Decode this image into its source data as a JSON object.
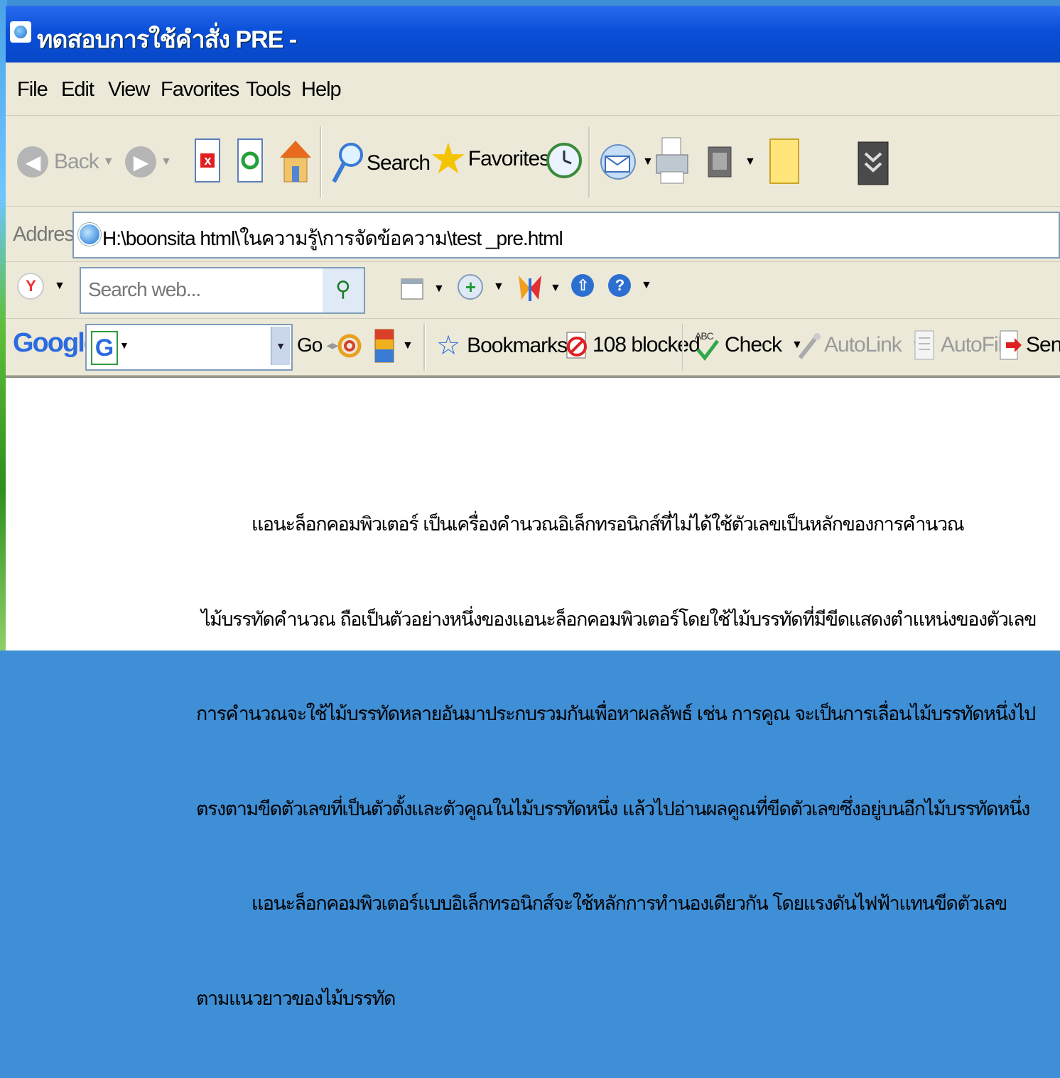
{
  "window": {
    "title": "ทดสอบการใช้คำสั่ง PRE -"
  },
  "menu": {
    "items": [
      "File",
      "Edit",
      "View",
      "Favorites",
      "Tools",
      "Help"
    ]
  },
  "toolbar": {
    "back_label": "Back",
    "search_label": "Search",
    "favorites_label": "Favorites"
  },
  "address": {
    "label": "Address",
    "url": "H:\\boonsita html\\ในความรู้\\การจัดข้อความ\\test _pre.html"
  },
  "yahoo_toolbar": {
    "search_placeholder": "Search web..."
  },
  "google_toolbar": {
    "logo": "Google",
    "go_label": "Go",
    "bookmarks_label": "Bookmarks",
    "blocked_label": "108 blocked",
    "check_label": "Check",
    "autolink_label": "AutoLink",
    "autofill_label": "AutoFill",
    "send_label": "Send"
  },
  "content": {
    "lines": [
      "           แอนะล็อกคอมพิวเตอร์ เป็นเครื่องคำนวณอิเล็กทรอนิกส์ที่ไม่ได้ใช้ตัวเลขเป็นหลักของการคำนวณ",
      " ไม้บรรทัดคำนวณ ถือเป็นตัวอย่างหนึ่งของแอนะล็อกคอมพิวเตอร์โดยใช้ไม้บรรทัดที่มีขีดแสดงตำแหน่งของตัวเลข",
      "การคำนวณจะใช้ไม้บรรทัดหลายอันมาประกบรวมกันเพื่อหาผลลัพธ์ เช่น การคูณ จะเป็นการเลื่อนไม้บรรทัดหนึ่งไป",
      "ตรงตามขีดตัวเลขที่เป็นตัวตั้งและตัวคูณในไม้บรรทัดหนึ่ง แล้วไปอ่านผลคูณที่ขีดตัวเลขซึ่งอยู่บนอีกไม้บรรทัดหนึ่ง",
      "           แอนะล็อกคอมพิวเตอร์แบบอิเล็กทรอนิกส์จะใช้หลักการทำนองเดียวกัน โดยแรงดันไฟฟ้าแทนขีดตัวเลข",
      "ตามแนวยาวของไม้บรรทัด"
    ]
  }
}
